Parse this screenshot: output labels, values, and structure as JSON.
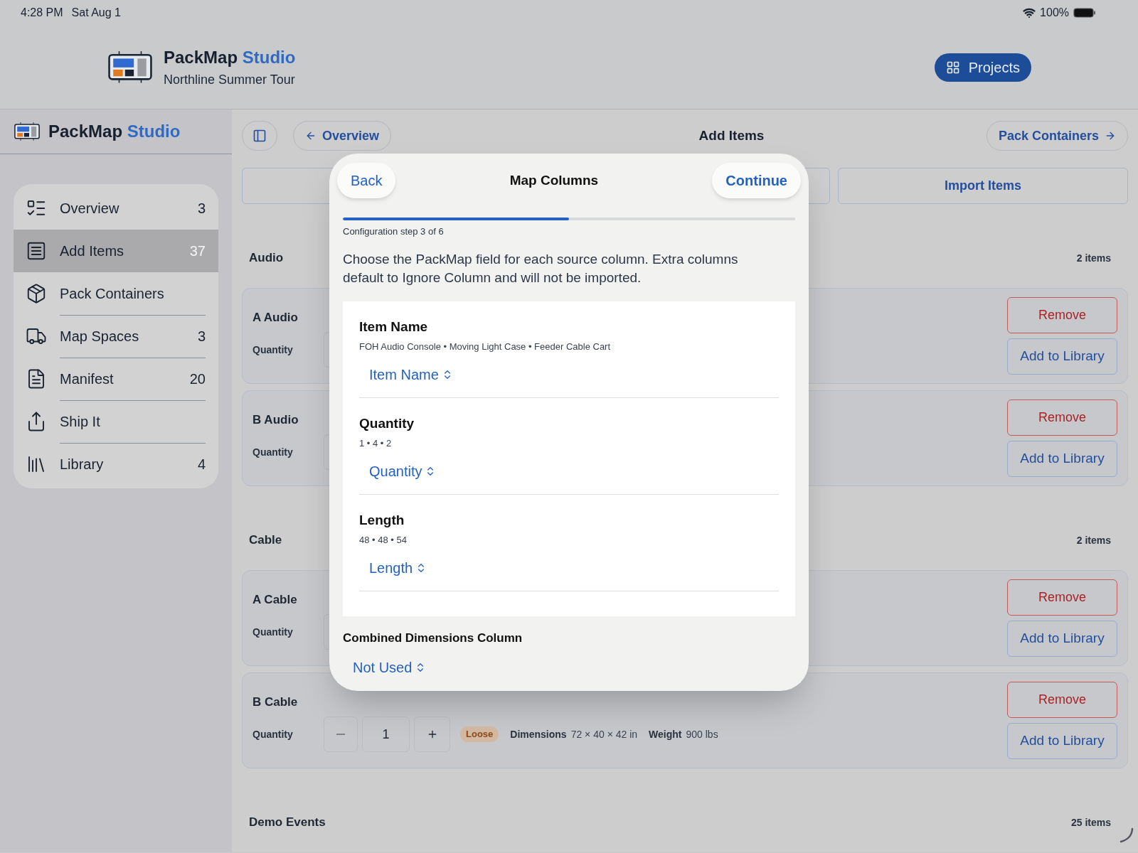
{
  "status_bar": {
    "time": "4:28 PM",
    "date": "Sat Aug 1",
    "battery": "100%"
  },
  "header": {
    "app_name": "PackMap",
    "app_name_accent": "Studio",
    "project": "Northline Summer Tour",
    "projects_button": "Projects"
  },
  "sidebar": {
    "title": "PackMap",
    "title_accent": "Studio",
    "items": [
      {
        "label": "Overview",
        "count": "3",
        "selected": false
      },
      {
        "label": "Add Items",
        "count": "37",
        "selected": true
      },
      {
        "label": "Pack Containers",
        "selected": false
      },
      {
        "label": "Map Spaces",
        "count": "3",
        "selected": false
      },
      {
        "label": "Manifest",
        "count": "20",
        "selected": false
      },
      {
        "label": "Ship It",
        "selected": false
      },
      {
        "label": "Library",
        "count": "4",
        "selected": false
      }
    ]
  },
  "toolbar": {
    "back_button": "Overview",
    "title": "Add Items",
    "next_button": "Pack Containers"
  },
  "actions": {
    "import_button": "Import Items"
  },
  "sections": [
    {
      "title": "Audio",
      "count": "2 items",
      "cards": [
        {
          "name": "A Audio",
          "quantity_label": "Quantity",
          "buttons": [
            "Remove",
            "Add to Library"
          ]
        },
        {
          "name": "B Audio",
          "quantity_label": "Quantity",
          "buttons": [
            "Remove",
            "Add to Library"
          ]
        }
      ]
    },
    {
      "title": "Cable",
      "count": "2 items",
      "cards": [
        {
          "name": "A Cable",
          "quantity_label": "Quantity",
          "buttons": [
            "Remove",
            "Add to Library"
          ]
        },
        {
          "name": "B Cable",
          "quantity_label": "Quantity",
          "value": "1",
          "tag": "Loose",
          "dimensions_label": "Dimensions",
          "dimensions": "72 × 40 × 42 in",
          "weight_label": "Weight",
          "weight": "900 lbs",
          "buttons": [
            "Remove",
            "Add to Library"
          ]
        }
      ]
    },
    {
      "title": "Demo Events",
      "count": "25 items"
    }
  ],
  "modal": {
    "back_button": "Back",
    "title": "Map Columns",
    "continue_button": "Continue",
    "progress": {
      "level": 0.5
    },
    "step": "Configuration step 3 of 6",
    "description": "Choose the PackMap field for each source column. Extra columns default to Ignore Column and will not be imported.",
    "fields": [
      {
        "name": "Item Name",
        "samples": "FOH Audio Console • Moving Light Case • Feeder Cable Cart",
        "selection": "Item Name"
      },
      {
        "name": "Quantity",
        "samples": "1 • 4 • 2",
        "selection": "Quantity"
      },
      {
        "name": "Length",
        "samples": "48 • 48 • 54",
        "selection": "Length"
      }
    ],
    "combined": {
      "label": "Combined Dimensions Column",
      "selection": "Not Used"
    }
  }
}
